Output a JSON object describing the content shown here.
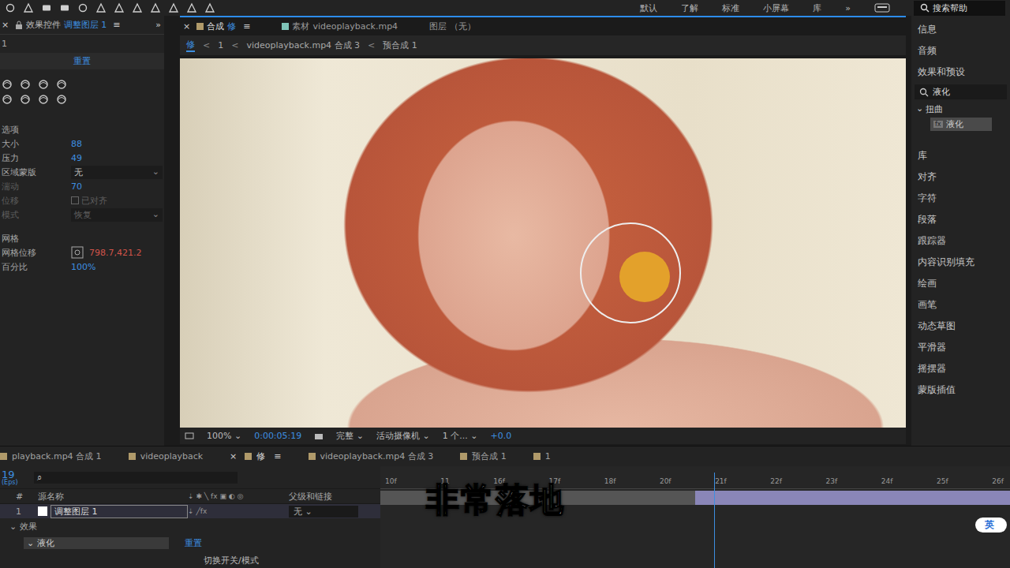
{
  "toolbar": {
    "workspaces": [
      {
        "label": "默认",
        "selected": false
      },
      {
        "label": "了解",
        "selected": false
      },
      {
        "label": "标准",
        "selected": false
      },
      {
        "label": "小屏幕",
        "selected": false
      },
      {
        "label": "库",
        "selected": false
      }
    ],
    "more": "»",
    "search_placeholder": "搜索帮助"
  },
  "effect_controls": {
    "close": "×",
    "tab": "效果控件",
    "layer": "调整图层 1",
    "menu": "≡",
    "expand": "»",
    "subtitle": "1",
    "reset": "重置",
    "properties": [
      {
        "label": "选项",
        "value": "",
        "kind": "header",
        "disabled": false,
        "checked": false
      },
      {
        "label": "大小",
        "value": "88",
        "kind": "number",
        "disabled": false,
        "checked": false
      },
      {
        "label": "压力",
        "value": "49",
        "kind": "number",
        "disabled": false,
        "checked": false
      },
      {
        "label": "区域蒙版",
        "value": "无",
        "kind": "dropdown",
        "disabled": false,
        "checked": false
      },
      {
        "label": "湍动",
        "value": "70",
        "kind": "number",
        "disabled": true,
        "checked": false
      },
      {
        "label": "位移",
        "value": "已对齐",
        "kind": "checkbox",
        "disabled": true,
        "checked": false
      },
      {
        "label": "模式",
        "value": "恢复",
        "kind": "dropdown",
        "disabled": true,
        "checked": false
      },
      {
        "label": "网格",
        "value": "",
        "kind": "header",
        "disabled": false,
        "checked": false
      },
      {
        "label": "网格位移",
        "value": "798.7,421.2",
        "kind": "point",
        "disabled": false,
        "checked": false
      },
      {
        "label": "百分比",
        "value": "100%",
        "kind": "number",
        "disabled": false,
        "checked": false
      }
    ]
  },
  "viewer": {
    "tabs": [
      {
        "close": "×",
        "kind_label": "合成",
        "name": "修",
        "menu": "≡",
        "selected": true,
        "color": "#b09a6a"
      },
      {
        "close": "",
        "kind_label": "素材",
        "name": "videoplayback.mp4",
        "menu": "",
        "selected": false,
        "color": "#7fc4b8"
      },
      {
        "close": "",
        "kind_label": "图层",
        "name": "（无）",
        "menu": "",
        "selected": false,
        "color": ""
      }
    ],
    "breadcrumb": [
      {
        "label": "修",
        "selected": true
      },
      {
        "label": "1",
        "selected": false
      },
      {
        "label": "videoplayback.mp4 合成 3",
        "selected": false
      },
      {
        "label": "预合成 1",
        "selected": false
      }
    ],
    "breadcrumb_separator": "<",
    "footer": {
      "zoom": "100%",
      "time": "0:00:05:19",
      "resolution": "完整",
      "camera": "活动摄像机",
      "views": "1 个...",
      "exposure": "+0.0"
    }
  },
  "right_panel": {
    "items_top": [
      "信息",
      "音频",
      "效果和预设"
    ],
    "search_value": "液化",
    "tree": {
      "label": "扭曲",
      "expanded": true,
      "children": [
        {
          "label": "液化",
          "selected": true
        }
      ]
    },
    "items_bottom": [
      "库",
      "对齐",
      "字符",
      "段落",
      "跟踪器",
      "内容识别填充",
      "绘画",
      "画笔",
      "动态草图",
      "平滑器",
      "摇摆器",
      "蒙版插值"
    ]
  },
  "timeline": {
    "tabs": [
      {
        "close": "",
        "label": "playback.mp4 合成 1",
        "menu": "",
        "selected": false
      },
      {
        "close": "",
        "label": "videoplayback",
        "menu": "",
        "selected": false
      },
      {
        "close": "×",
        "label": "修",
        "menu": "≡",
        "selected": true
      },
      {
        "close": "",
        "label": "videoplayback.mp4 合成 3",
        "menu": "",
        "selected": false
      },
      {
        "close": "",
        "label": "预合成 1",
        "menu": "",
        "selected": false
      },
      {
        "close": "",
        "label": "1",
        "menu": "",
        "selected": false
      }
    ],
    "current_frame": "19",
    "fps": "(Eps)",
    "columns": {
      "index": "#",
      "name": "源名称",
      "parent": "父级和链接"
    },
    "layers": [
      {
        "index": "1",
        "name": "调整图层 1",
        "parent": "无",
        "selected": true
      }
    ],
    "effects_label": "效果",
    "effect": {
      "name": "液化",
      "reset": "重置"
    },
    "ruler": [
      "10f",
      "11",
      "16f",
      "17f",
      "18f",
      "20f",
      "21f",
      "22f",
      "23f",
      "24f",
      "25f",
      "26f"
    ],
    "playhead": 0.53,
    "footer": "切换开关/模式"
  },
  "caption": "非常落地",
  "ime": "英"
}
